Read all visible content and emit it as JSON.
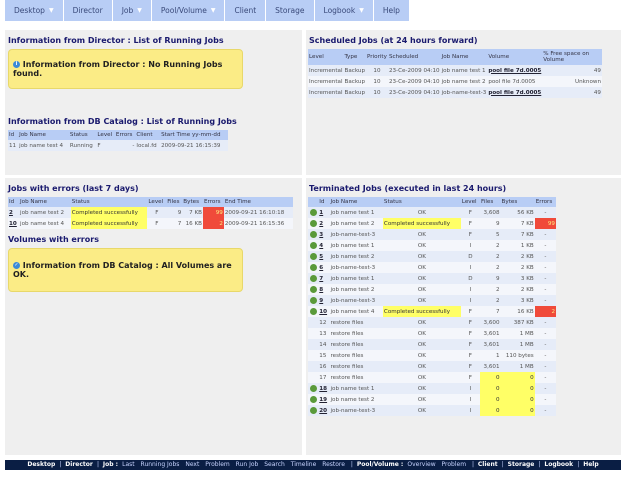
{
  "menu": [
    "Desktop",
    "Director",
    "Job",
    "Pool/Volume",
    "Client",
    "Storage",
    "Logbook",
    "Help"
  ],
  "menu_dropdown": [
    true,
    false,
    true,
    true,
    false,
    false,
    true,
    false
  ],
  "director": {
    "title": "Information from Director : List of Running Jobs",
    "message": "Information from Director : No Running Jobs found."
  },
  "catalog_running": {
    "title": "Information from DB Catalog : List of Running Jobs",
    "headers": [
      "Id",
      "Job Name",
      "Status",
      "Level",
      "Errors",
      "Client",
      "Start Time yy-mm-dd"
    ],
    "rows": [
      [
        "11",
        "job name test 4",
        "Running",
        "F",
        "-",
        "local.fd",
        "2009-09-21 16:15:39"
      ]
    ]
  },
  "errors": {
    "title": "Jobs with errors (last 7 days)",
    "headers": [
      "Id",
      "Job Name",
      "Status",
      "Level",
      "Files",
      "Bytes",
      "Errors",
      "End Time"
    ],
    "rows": [
      [
        "2",
        "job name test 2",
        "Completed successfully",
        "F",
        "9",
        "7 KB",
        "99",
        "2009-09-21 16:10:18"
      ],
      [
        "10",
        "job name test 4",
        "Completed successfully",
        "F",
        "7",
        "16 KB",
        "2",
        "2009-09-21 16:15:36"
      ]
    ]
  },
  "volumes": {
    "title": "Volumes with errors",
    "message": "Information from DB Catalog : All Volumes are OK."
  },
  "scheduled": {
    "title": "Scheduled Jobs (at 24 hours forward)",
    "headers": [
      "Level",
      "Type",
      "Priority",
      "Scheduled",
      "Job Name",
      "Volume",
      "% Free space on Volume"
    ],
    "rows": [
      [
        "Incremental",
        "Backup",
        "10",
        "23-Ce-2009 04:10",
        "job name test 1",
        "pool file 7d.0005",
        "49"
      ],
      [
        "Incremental",
        "Backup",
        "10",
        "23-Ce-2009 04:10",
        "job name test 2",
        "pool file 7d.0005",
        "Unknown"
      ],
      [
        "Incremental",
        "Backup",
        "10",
        "23-Ce-2009 04:10",
        "job-name-test-3",
        "pool file 7d.0005",
        "49"
      ]
    ]
  },
  "terminated": {
    "title": "Terminated Jobs (executed in last 24 hours)",
    "headers": [
      "Id",
      "Job Name",
      "Status",
      "Level",
      "Files",
      "Bytes",
      "Errors"
    ],
    "rows": [
      [
        "1",
        "job name test 1",
        "OK",
        "F",
        "3,608",
        "56 KB",
        "-"
      ],
      [
        "2",
        "job name test 2",
        "Completed successfully",
        "F",
        "9",
        "7 KB",
        "99"
      ],
      [
        "3",
        "job-name-test-3",
        "OK",
        "F",
        "5",
        "7 KB",
        "-"
      ],
      [
        "4",
        "job name test 1",
        "OK",
        "I",
        "2",
        "1 KB",
        "-"
      ],
      [
        "5",
        "job name test 2",
        "OK",
        "D",
        "2",
        "2 KB",
        "-"
      ],
      [
        "6",
        "job-name-test-3",
        "OK",
        "I",
        "2",
        "2 KB",
        "-"
      ],
      [
        "7",
        "job name test 1",
        "OK",
        "D",
        "9",
        "3 KB",
        "-"
      ],
      [
        "8",
        "job name test 2",
        "OK",
        "I",
        "2",
        "2 KB",
        "-"
      ],
      [
        "9",
        "job-name-test-3",
        "OK",
        "I",
        "2",
        "3 KB",
        "-"
      ],
      [
        "10",
        "job name test 4",
        "Completed successfully",
        "F",
        "7",
        "16 KB",
        "2"
      ],
      [
        "12",
        "restore files",
        "OK",
        "F",
        "3,600",
        "387 KB",
        "-"
      ],
      [
        "13",
        "restore files",
        "OK",
        "F",
        "3,601",
        "1 MB",
        "-"
      ],
      [
        "14",
        "restore files",
        "OK",
        "F",
        "3,601",
        "1 MB",
        "-"
      ],
      [
        "15",
        "restore files",
        "OK",
        "F",
        "1",
        "110 bytes",
        "-"
      ],
      [
        "16",
        "restore files",
        "OK",
        "F",
        "3,601",
        "1 MB",
        "-"
      ],
      [
        "17",
        "restore files",
        "OK",
        "F",
        "0",
        "0",
        "-"
      ],
      [
        "18",
        "job name test 1",
        "OK",
        "I",
        "0",
        "0",
        "-"
      ],
      [
        "19",
        "job name test 2",
        "OK",
        "I",
        "0",
        "0",
        "-"
      ],
      [
        "20",
        "job-name-test-3",
        "OK",
        "I",
        "0",
        "0",
        "-"
      ]
    ]
  },
  "footer": [
    [
      "Desktop",
      true
    ],
    [
      "|",
      false
    ],
    [
      "Director",
      true
    ],
    [
      "|",
      false
    ],
    [
      "Job :",
      true
    ],
    [
      "Last",
      false
    ],
    [
      "Running Jobs",
      false
    ],
    [
      "Next",
      false
    ],
    [
      "Problem",
      false
    ],
    [
      "Run Job",
      false
    ],
    [
      "Search",
      false
    ],
    [
      "Timeline",
      false
    ],
    [
      "Restore",
      false
    ],
    [
      "|",
      false
    ],
    [
      "Pool/Volume :",
      true
    ],
    [
      "Overview",
      false
    ],
    [
      "Problem",
      false
    ],
    [
      "|",
      false
    ],
    [
      "Client",
      true
    ],
    [
      "|",
      false
    ],
    [
      "Storage",
      true
    ],
    [
      "|",
      false
    ],
    [
      "Logbook",
      true
    ],
    [
      "|",
      false
    ],
    [
      "Help",
      true
    ]
  ]
}
